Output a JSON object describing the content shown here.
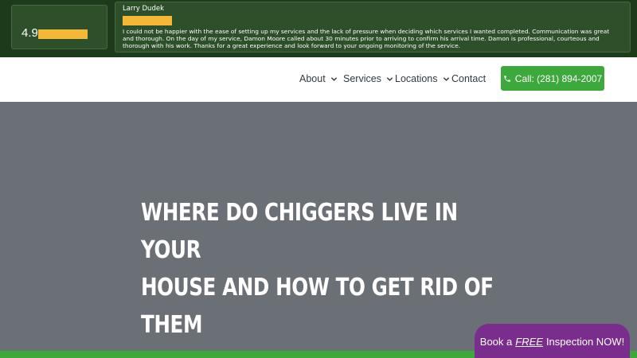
{
  "reviews": {
    "rating_value": "4.9",
    "rating_stars_fraction": 0.98,
    "author": "Larry Dudek",
    "review_stars_fraction": 1.0,
    "text": "I could not be happier with the ease of setting up my services and the lack of pressure when deciding which services I wanted completed. Communication was great and thorough. On the day of my service, Damon Moore called about 30 minutes prior to arriving to confirm his arrival time. Damon is professional, courteous and thorough with his work. Thanks for a great experience and look forward to your ongoing monitoring of the service.",
    "star_color": "#f5b738"
  },
  "nav": {
    "items": [
      {
        "label": "About",
        "has_dropdown": true
      },
      {
        "label": "Services",
        "has_dropdown": true
      },
      {
        "label": "Locations",
        "has_dropdown": true
      },
      {
        "label": "Contact",
        "has_dropdown": false
      }
    ],
    "call_button": {
      "label": "Call: (281) 894-2007",
      "icon": "phone-icon"
    }
  },
  "hero": {
    "title_line_1": "WHERE DO CHIGGERS LIVE IN YOUR",
    "title_line_2": "HOUSE AND HOW TO GET RID OF THEM"
  },
  "cta": {
    "prefix": "Book a",
    "emphasis": "FREE",
    "suffix": "Inspection NOW!"
  },
  "colors": {
    "accent_green": "#3da83b",
    "review_bg": "#1d3a1a",
    "cta_purple": "#7a2d8c",
    "hero_gray": "#6b6f76"
  }
}
